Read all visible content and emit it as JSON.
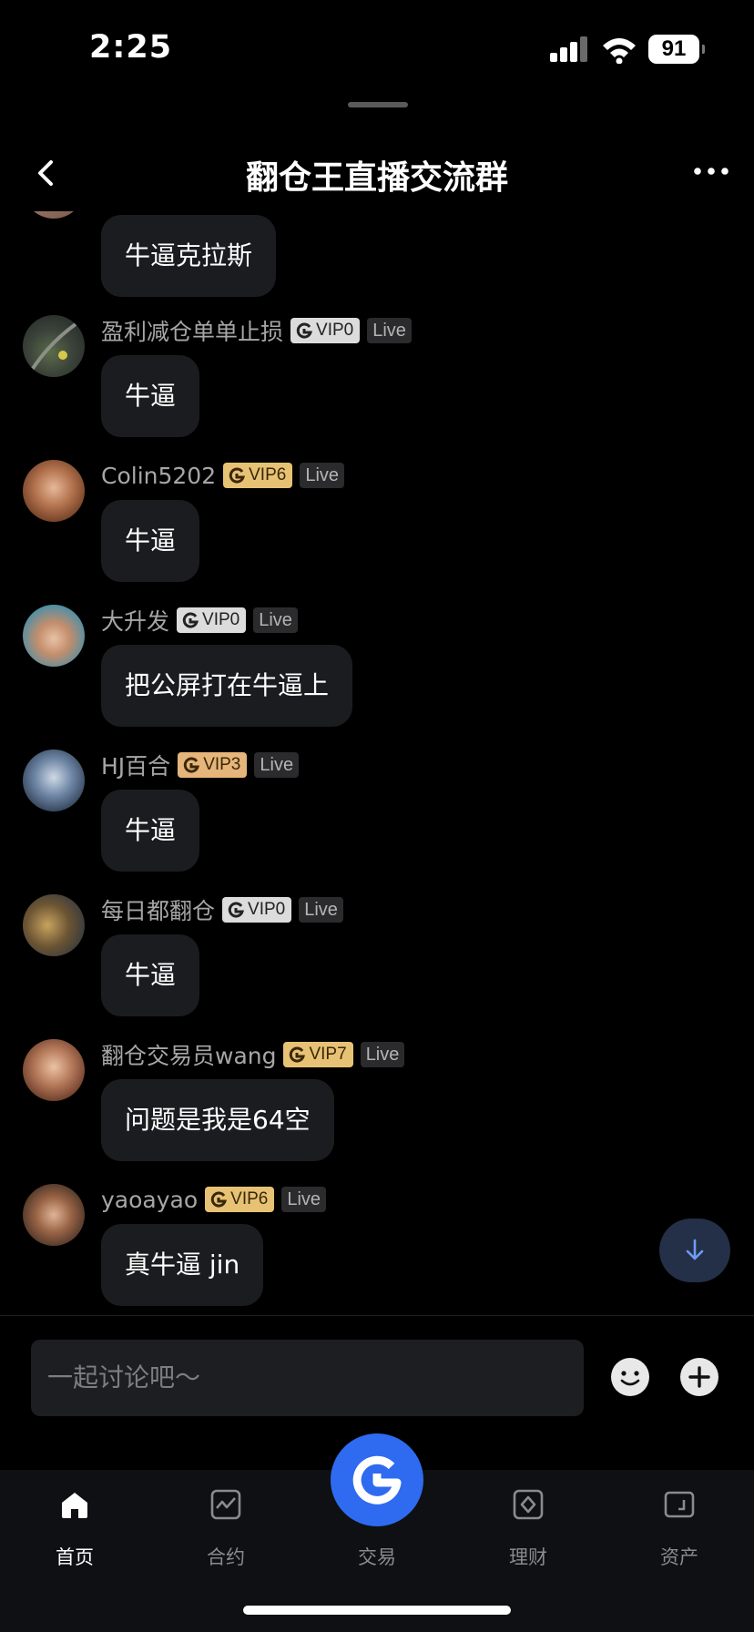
{
  "status_bar": {
    "time": "2:25",
    "battery": "91"
  },
  "header": {
    "title": "翻仓王直播交流群"
  },
  "first_message": {
    "text": "牛逼克拉斯"
  },
  "messages": [
    {
      "name": "盈利减仓单单止损",
      "vip": "VIP0",
      "live": "Live",
      "text": "牛逼"
    },
    {
      "name": "Colin5202",
      "vip": "VIP6",
      "live": "Live",
      "text": "牛逼"
    },
    {
      "name": "大升发",
      "vip": "VIP0",
      "live": "Live",
      "text": "把公屏打在牛逼上"
    },
    {
      "name": "HJ百合",
      "vip": "VIP3",
      "live": "Live",
      "text": "牛逼"
    },
    {
      "name": "每日都翻仓",
      "vip": "VIP0",
      "live": "Live",
      "text": "牛逼"
    },
    {
      "name": "翻仓交易员wang",
      "vip": "VIP7",
      "live": "Live",
      "text": "问题是我是64空"
    },
    {
      "name": "yaoayao",
      "vip": "VIP6",
      "live": "Live",
      "text": "真牛逼 jin"
    }
  ],
  "composer": {
    "placeholder": "一起讨论吧～"
  },
  "tabbar": {
    "tabs": [
      {
        "label": "首页",
        "icon": "home-icon"
      },
      {
        "label": "合约",
        "icon": "chart-icon"
      },
      {
        "label": "交易",
        "icon": "trade-logo-icon"
      },
      {
        "label": "理财",
        "icon": "finance-icon"
      },
      {
        "label": "资产",
        "icon": "wallet-icon"
      }
    ]
  },
  "colors": {
    "accent": "#2f6bf0",
    "vip_gold": "#e7c275",
    "vip_silver": "#dcdcdc"
  }
}
